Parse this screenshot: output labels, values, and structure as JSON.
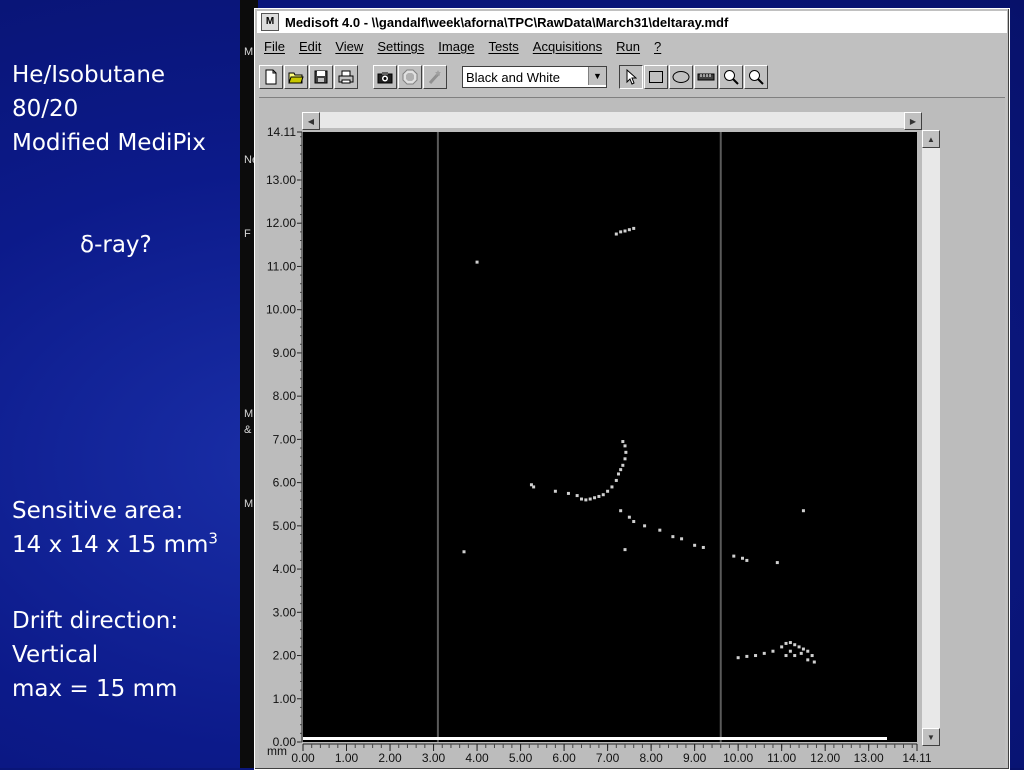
{
  "slide": {
    "gas_lines": [
      "He/Isobutane",
      "80/20",
      "Modified MediPix"
    ],
    "delta_ray": "δ-ray?",
    "sensitive_area_label": "Sensitive area:",
    "sensitive_area_value": "14 x 14 x 15 mm",
    "sensitive_area_sup": "3",
    "drift_label": "Drift direction:",
    "drift_value": "Vertical",
    "drift_max": "max = 15 mm",
    "behind_window_fragments": [
      "M",
      "Ne",
      "F",
      "M",
      "&",
      "M"
    ]
  },
  "window": {
    "title": "Medisoft 4.0 - \\\\gandalf\\week\\aforna\\TPC\\RawData\\March31\\deltaray.mdf",
    "icon_letter": "M"
  },
  "menu": [
    "File",
    "Edit",
    "View",
    "Settings",
    "Image",
    "Tests",
    "Acquisitions",
    "Run",
    "?"
  ],
  "toolbar": {
    "buttons": [
      "new-file-icon",
      "open-folder-icon",
      "save-disk-icon",
      "print-icon",
      "camera-icon",
      "stop-icon",
      "wand-icon"
    ],
    "mode_value": "Black and White",
    "tools": [
      "pointer-arrow-icon",
      "rectangle-icon",
      "ellipse-icon",
      "ruler-icon",
      "zoom-in-icon",
      "zoom-out-icon"
    ]
  },
  "image_view": {
    "x_unit": "mm",
    "x_ticks": [
      "0.00",
      "1.00",
      "2.00",
      "3.00",
      "4.00",
      "5.00",
      "6.00",
      "7.00",
      "8.00",
      "9.00",
      "10.00",
      "11.00",
      "12.00",
      "13.00",
      "14.11"
    ],
    "y_ticks": [
      "14.11",
      "13.00",
      "12.00",
      "11.00",
      "10.00",
      "9.00",
      "8.00",
      "7.00",
      "6.00",
      "5.00",
      "4.00",
      "3.00",
      "2.00",
      "1.00",
      "0.00"
    ],
    "range_mm": [
      0,
      14.11
    ],
    "dead_columns_mm": [
      3.1,
      9.6
    ],
    "hits_mm": [
      [
        7.3,
        11.8
      ],
      [
        7.4,
        11.82
      ],
      [
        7.5,
        11.85
      ],
      [
        7.6,
        11.88
      ],
      [
        7.2,
        11.75
      ],
      [
        4.0,
        11.1
      ],
      [
        7.35,
        6.95
      ],
      [
        7.4,
        6.85
      ],
      [
        7.42,
        6.7
      ],
      [
        7.4,
        6.55
      ],
      [
        7.35,
        6.4
      ],
      [
        7.3,
        6.3
      ],
      [
        7.25,
        6.2
      ],
      [
        7.2,
        6.05
      ],
      [
        7.1,
        5.9
      ],
      [
        7.0,
        5.8
      ],
      [
        6.9,
        5.72
      ],
      [
        6.8,
        5.68
      ],
      [
        6.7,
        5.65
      ],
      [
        6.6,
        5.62
      ],
      [
        6.5,
        5.6
      ],
      [
        6.4,
        5.62
      ],
      [
        6.3,
        5.7
      ],
      [
        6.1,
        5.75
      ],
      [
        5.8,
        5.8
      ],
      [
        5.3,
        5.9
      ],
      [
        5.25,
        5.95
      ],
      [
        7.3,
        5.35
      ],
      [
        7.5,
        5.2
      ],
      [
        7.6,
        5.1
      ],
      [
        7.85,
        5.0
      ],
      [
        8.2,
        4.9
      ],
      [
        8.5,
        4.75
      ],
      [
        8.7,
        4.7
      ],
      [
        9.0,
        4.55
      ],
      [
        9.2,
        4.5
      ],
      [
        3.7,
        4.4
      ],
      [
        7.4,
        4.45
      ],
      [
        9.9,
        4.3
      ],
      [
        10.1,
        4.25
      ],
      [
        10.2,
        4.2
      ],
      [
        10.9,
        4.15
      ],
      [
        11.5,
        5.35
      ],
      [
        10.0,
        1.95
      ],
      [
        10.2,
        1.98
      ],
      [
        10.4,
        2.0
      ],
      [
        10.6,
        2.05
      ],
      [
        10.8,
        2.1
      ],
      [
        11.0,
        2.2
      ],
      [
        11.1,
        2.28
      ],
      [
        11.2,
        2.3
      ],
      [
        11.3,
        2.25
      ],
      [
        11.4,
        2.2
      ],
      [
        11.5,
        2.15
      ],
      [
        11.6,
        2.1
      ],
      [
        11.7,
        2.0
      ],
      [
        11.75,
        1.85
      ],
      [
        11.6,
        1.9
      ],
      [
        11.45,
        2.05
      ],
      [
        11.3,
        2.0
      ],
      [
        11.2,
        2.1
      ],
      [
        11.1,
        2.0
      ]
    ]
  },
  "colors": {
    "slide_bg": "#0c1a8a",
    "image_bg": "#000000",
    "hit": "#d0d0d0",
    "dead_column": "#5a5a5a",
    "window_face": "#c0c0c0"
  }
}
